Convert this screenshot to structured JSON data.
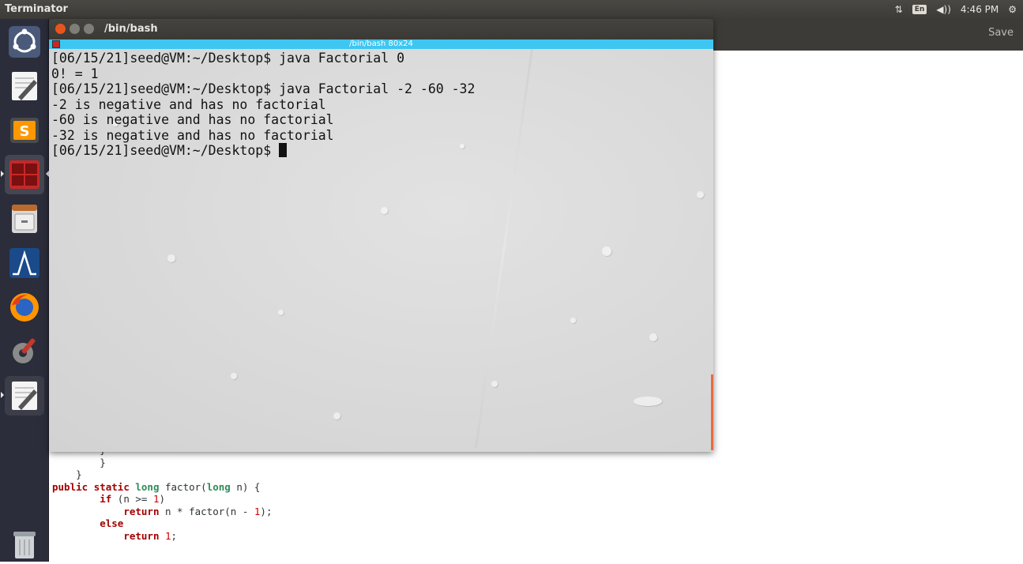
{
  "top_panel": {
    "app_name": "Terminator",
    "input_indicator": "En",
    "clock": "4:46 PM"
  },
  "launcher": {
    "items": [
      {
        "icon": "ubuntu-dash-icon"
      },
      {
        "icon": "text-editor-icon"
      },
      {
        "icon": "sublime-text-icon"
      },
      {
        "icon": "terminator-icon"
      },
      {
        "icon": "file-cabinet-icon"
      },
      {
        "icon": "wireshark-icon"
      },
      {
        "icon": "firefox-icon"
      },
      {
        "icon": "system-settings-icon"
      },
      {
        "icon": "gedit-icon"
      },
      {
        "icon": "trash-icon"
      }
    ]
  },
  "gedit": {
    "save_label": "Save",
    "code_lines": [
      "        }",
      "        }",
      "    }",
      "public static long factor(long n) {",
      "        if (n >= 1)",
      "            return n * factor(n - 1);",
      "        else",
      "            return 1;"
    ]
  },
  "terminal": {
    "window_title": "/bin/bash",
    "tab_label": "/bin/bash 80x24",
    "lines": [
      "[06/15/21]seed@VM:~/Desktop$ java Factorial 0",
      "0! = 1",
      "[06/15/21]seed@VM:~/Desktop$ java Factorial -2 -60 -32",
      "-2 is negative and has no factorial",
      "-60 is negative and has no factorial",
      "-32 is negative and has no factorial"
    ],
    "prompt": "[06/15/21]seed@VM:~/Desktop$ "
  },
  "colors": {
    "panel": "#3c3b37",
    "launcher": "#2b2d3a",
    "tab_bar": "#3ec6f2",
    "close_button": "#e9541d"
  }
}
